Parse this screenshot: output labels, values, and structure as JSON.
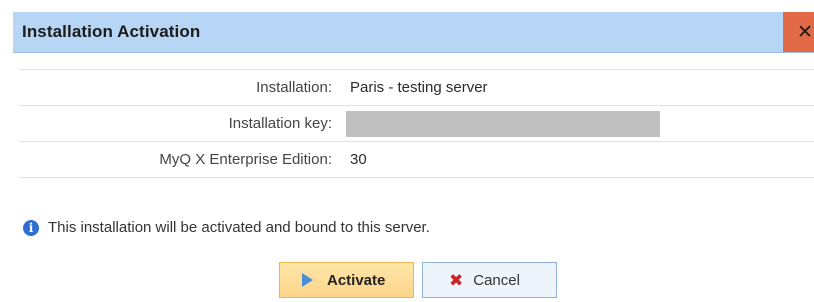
{
  "dialog": {
    "title": "Installation Activation",
    "close_icon": "close-icon",
    "close_glyph": "✕"
  },
  "form": {
    "rows": [
      {
        "label": "Installation:",
        "value": "Paris - testing server"
      },
      {
        "label": "Installation key:",
        "value": ""
      },
      {
        "label": "MyQ X Enterprise Edition:",
        "value": "30"
      }
    ]
  },
  "info": {
    "icon": "info-icon",
    "glyph": "i",
    "text": "This installation will be activated and bound to this server."
  },
  "buttons": {
    "activate_label": "Activate",
    "activate_icon": "play-icon",
    "cancel_label": "Cancel",
    "cancel_icon": "x-icon",
    "cancel_glyph": "✖"
  },
  "colors": {
    "titlebar": "#b7d5f4",
    "close_button": "#e36a47",
    "activate_button": "#fcd58a",
    "cancel_button": "#eef4fc",
    "info_icon": "#2f6fd0",
    "cancel_icon": "#d02222"
  }
}
